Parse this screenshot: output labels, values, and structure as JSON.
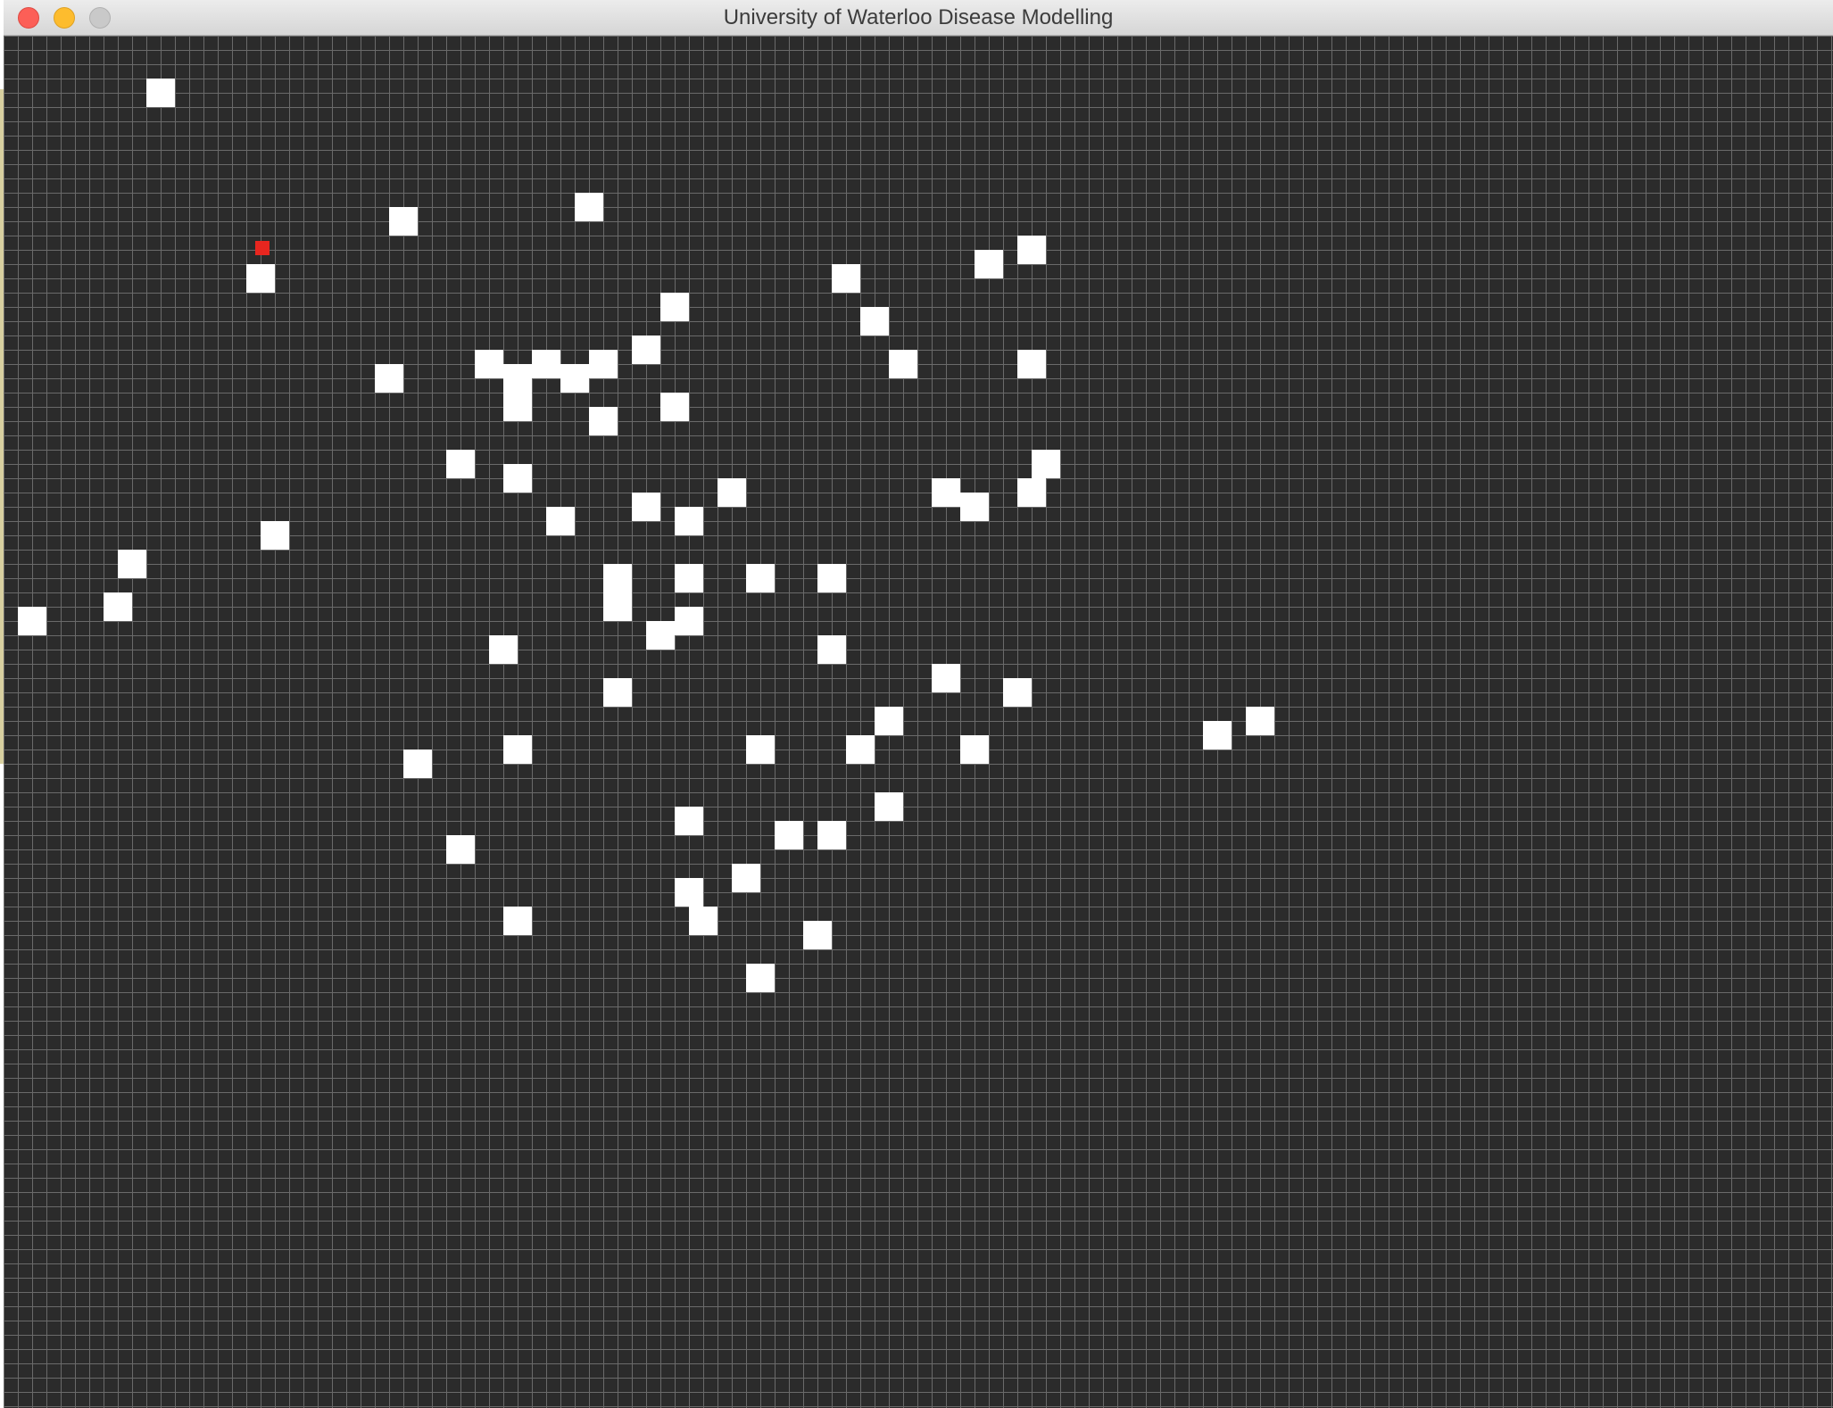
{
  "window": {
    "title": "University of Waterloo Disease Modelling"
  },
  "colors": {
    "background": "#2b2b2b",
    "grid_line": "#6a6a6a",
    "healthy": "#ffffff",
    "infected": "#e8261f"
  }
}
